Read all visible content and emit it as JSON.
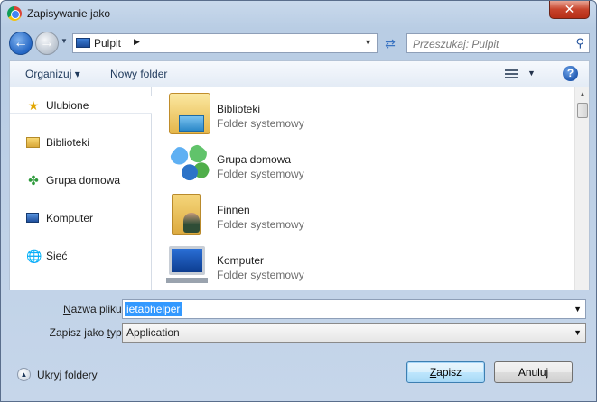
{
  "window": {
    "title": "Zapisywanie jako",
    "close_label": "✕"
  },
  "nav": {
    "back_label": "←",
    "forward_label": "→",
    "recent_label": "▼",
    "address": {
      "location": "Pulpit",
      "arrow": "▶",
      "dropdown": "▼"
    },
    "refresh_label": "⇄",
    "search": {
      "placeholder": "Przeszukaj: Pulpit",
      "icon": "⚲"
    }
  },
  "toolbar": {
    "organize_label": "Organizuj ▾",
    "new_folder_label": "Nowy folder",
    "view_dropdown": "▼",
    "help_label": "?"
  },
  "sidebar": {
    "items": [
      {
        "label": "Ulubione",
        "icon": "★"
      },
      {
        "label": "Biblioteki",
        "icon": ""
      },
      {
        "label": "Grupa domowa",
        "icon": "✤"
      },
      {
        "label": "Komputer",
        "icon": ""
      },
      {
        "label": "Sieć",
        "icon": "🌐"
      }
    ]
  },
  "files": [
    {
      "name": "Biblioteki",
      "type": "Folder systemowy"
    },
    {
      "name": "Grupa domowa",
      "type": "Folder systemowy"
    },
    {
      "name": "Finnen",
      "type": "Folder systemowy"
    },
    {
      "name": "Komputer",
      "type": "Folder systemowy"
    }
  ],
  "scrollbar": {
    "up_arrow": "▲"
  },
  "form": {
    "filename_label_u": "N",
    "filename_label_rest": "azwa pliku:",
    "filename_value": "ietabhelper",
    "filetype_label_pre": "Zapisz jako ",
    "filetype_label_u": "t",
    "filetype_label_rest": "yp:",
    "filetype_value": "Application",
    "dropdown": "▼"
  },
  "footer": {
    "hide_folders_label": "Ukryj foldery",
    "hide_folders_arrow": "▲",
    "save_u": "Z",
    "save_rest": "apisz",
    "cancel_label": "Anuluj"
  },
  "colors": {
    "accent": "#3399ff",
    "frame": "#b9cde4",
    "secondary_text": "#6d6d6d"
  }
}
